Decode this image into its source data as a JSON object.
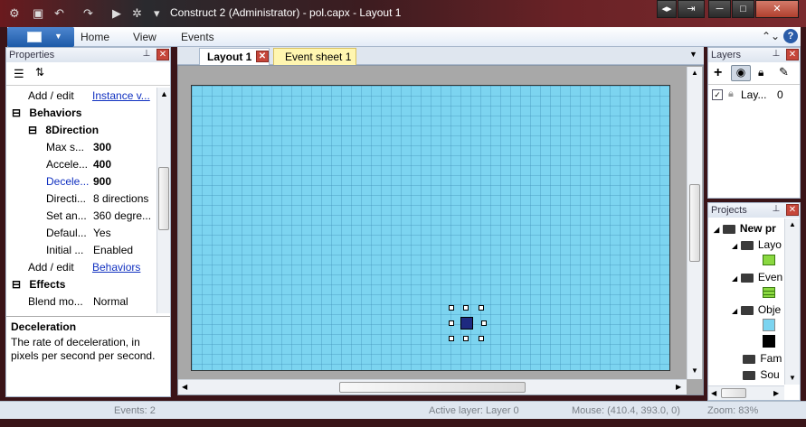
{
  "window": {
    "title": "Construct 2 (Administrator) - pol.capx - Layout 1"
  },
  "ribbon": {
    "tabs": [
      "Home",
      "View",
      "Events"
    ]
  },
  "properties": {
    "title": "Properties",
    "rows": [
      {
        "label": "Add / edit",
        "value": "Instance v...",
        "kind": "link-row"
      },
      {
        "label": "Behaviors",
        "kind": "section"
      },
      {
        "label": "8Direction",
        "kind": "subsection"
      },
      {
        "label": "Max s...",
        "value": "300",
        "bold": true
      },
      {
        "label": "Accele...",
        "value": "400",
        "bold": true
      },
      {
        "label": "Decele...",
        "value": "900",
        "bold": true,
        "link": true
      },
      {
        "label": "Directi...",
        "value": "8 directions"
      },
      {
        "label": "Set an...",
        "value": "360 degre..."
      },
      {
        "label": "Defaul...",
        "value": "Yes"
      },
      {
        "label": "Initial ...",
        "value": "Enabled"
      },
      {
        "label": "Add / edit",
        "value": "Behaviors",
        "kind": "link-row2"
      },
      {
        "label": "Effects",
        "kind": "section"
      },
      {
        "label": "Blend mo...",
        "value": "Normal",
        "kind": "dropdown"
      }
    ],
    "description": {
      "title": "Deceleration",
      "text": "The rate of deceleration, in pixels per second per second."
    }
  },
  "tabs": {
    "layout": "Layout 1",
    "event_sheet": "Event sheet 1"
  },
  "layers": {
    "title": "Layers",
    "row": {
      "name": "Lay...",
      "index": "0"
    }
  },
  "projects": {
    "title": "Projects",
    "items": [
      "New pr",
      "Layo",
      "Even",
      "Obje",
      "Fam",
      "Sou"
    ]
  },
  "status": {
    "events": "Events: 2",
    "active_layer": "Active layer: Layer 0",
    "mouse": "Mouse: (410.4, 393.0, 0)",
    "zoom": "Zoom: 83%"
  },
  "colors": {
    "layout_bg": "#7cd4f0",
    "title_bar": "#3c1c20",
    "accent": "#1d5aa8",
    "close": "#c6463a"
  }
}
